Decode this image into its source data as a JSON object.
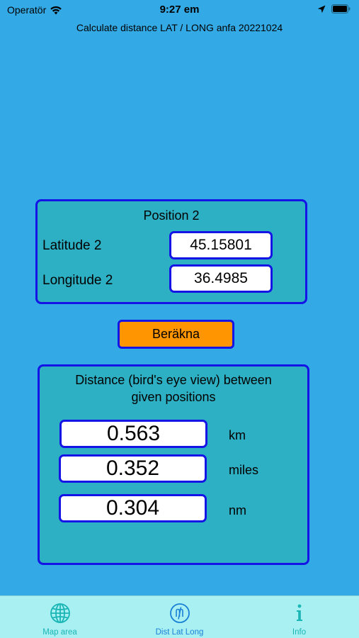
{
  "status_bar": {
    "carrier": "Operatör",
    "time": "9:27 em"
  },
  "app": {
    "title": "Calculate distance LAT / LONG anfa 20221024"
  },
  "position2": {
    "heading": "Position 2",
    "latitude_label": "Latitude 2",
    "latitude_value": "45.15801",
    "longitude_label": "Longitude 2",
    "longitude_value": "36.4985"
  },
  "calculate_button": {
    "label": "Beräkna"
  },
  "distance": {
    "heading_line1": "Distance (bird's eye view) between",
    "heading_line2": "given positions",
    "rows": [
      {
        "value": "0.563",
        "unit": "km"
      },
      {
        "value": "0.352",
        "unit": "miles"
      },
      {
        "value": "0.304",
        "unit": "nm"
      }
    ]
  },
  "tabs": [
    {
      "label": "Map area",
      "icon": "globe-icon",
      "active": false
    },
    {
      "label": "Dist Lat Long",
      "icon": "dist-icon",
      "active": true
    },
    {
      "label": "Info",
      "icon": "info-icon",
      "active": false
    }
  ],
  "colors": {
    "background": "#33aae6",
    "panel": "#2eb0c4",
    "border": "#1414e6",
    "button": "#ff9500",
    "tab_bar": "#a8f0f2",
    "tab_active": "#1a80d6",
    "tab_inactive": "#1ab5b5"
  }
}
